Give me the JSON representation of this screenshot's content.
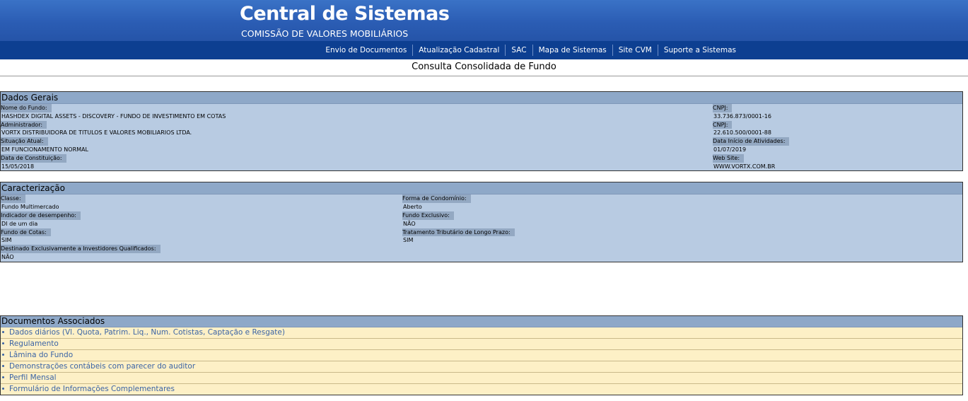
{
  "header": {
    "title": "Central de Sistemas",
    "subtitle": "COMISSÃO DE VALORES MOBILIÁRIOS"
  },
  "nav": [
    "Envio de Documentos",
    "Atualização Cadastral",
    "SAC",
    "Mapa de Sistemas",
    "Site CVM",
    "Suporte a Sistemas"
  ],
  "page_title": "Consulta Consolidada de Fundo",
  "dados_gerais": {
    "heading": "Dados Gerais",
    "nome_label": "Nome do Fundo:",
    "nome_value": "HASHDEX DIGITAL ASSETS - DISCOVERY - FUNDO DE INVESTIMENTO EM COTAS",
    "cnpj1_label": "CNPJ:",
    "cnpj1_value": "33.736.873/0001-16",
    "admin_label": "Administrador:",
    "admin_value": "VORTX DISTRIBUIDORA DE TITULOS E VALORES MOBILIARIOS LTDA.",
    "cnpj2_label": "CNPJ:",
    "cnpj2_value": "22.610.500/0001-88",
    "situacao_label": "Situação Atual:",
    "situacao_value": "EM FUNCIONAMENTO NORMAL",
    "inicio_label": "Data Início de Atividades:",
    "inicio_value": "01/07/2019",
    "constituicao_label": "Data de Constituição:",
    "constituicao_value": "15/05/2018",
    "website_label": "Web Site:",
    "website_value": "WWW.VORTX.COM.BR"
  },
  "caracterizacao": {
    "heading": "Caracterização",
    "classe_label": "Classe:",
    "classe_value": "Fundo Multimercado",
    "condominio_label": "Forma de Condomínio:",
    "condominio_value": "Aberto",
    "indicador_label": "Indicador de desempenho:",
    "indicador_value": "DI de um dia",
    "exclusivo_label": "Fundo Exclusivo:",
    "exclusivo_value": "NÃO",
    "cotas_label": "Fundo de Cotas:",
    "cotas_value": "SIM",
    "tributario_label": "Tratamento Tributário de Longo Prazo:",
    "tributario_value": "SIM",
    "qualificados_label": "Destinado Exclusivamente a Investidores Qualificados:",
    "qualificados_value": "NÃO"
  },
  "documentos": {
    "heading": "Documentos Associados",
    "items": [
      "Dados diários (Vl. Quota, Patrim. Liq., Num. Cotistas, Captação e Resgate)",
      "Regulamento",
      "Lâmina do Fundo",
      "Demonstrações contábeis com parecer do auditor",
      "Perfil Mensal",
      "Formulário de Informações Complementares"
    ]
  }
}
